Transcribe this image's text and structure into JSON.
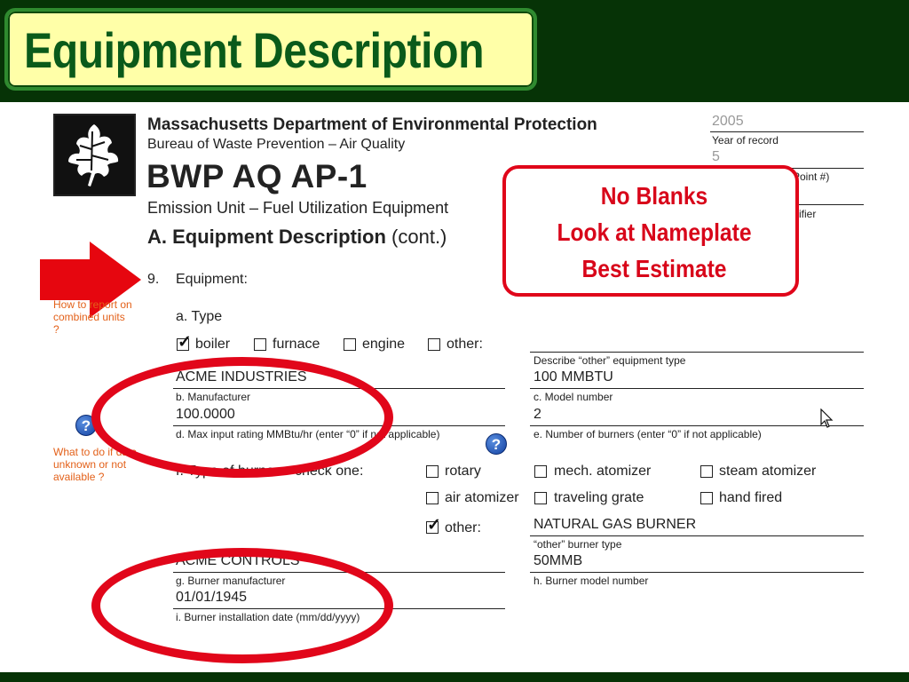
{
  "slide": {
    "title": "Equipment Description"
  },
  "form": {
    "agency": "Massachusetts Department of Environmental Protection",
    "bureau": "Bureau of Waste Prevention – Air Quality",
    "code": "BWP AQ AP-1",
    "subtitle": "Emission Unit – Fuel Utilization Equipment",
    "section_bold": "A. Equipment Description",
    "section_rest": " (cont.)",
    "meta": {
      "year_value": "2005",
      "year_label": "Year of record",
      "point_value": "5",
      "point_label_partial": "Point #)",
      "identifier_label_partial": "ifier"
    },
    "question_number": "9.",
    "question_label": "Equipment:",
    "type_label": "a. Type",
    "type_options": {
      "boiler": "boiler",
      "furnace": "furnace",
      "engine": "engine",
      "other": "other:"
    },
    "fields": {
      "other_type_label": "Describe “other” equipment type",
      "manufacturer_value": "ACME INDUSTRIES",
      "manufacturer_label": "b.  Manufacturer",
      "model_value": "100 MMBTU",
      "model_label": "c. Model number",
      "max_input_value": "100.0000",
      "max_input_label": "d. Max input rating MMBtu/hr (enter “0” if not applicable)",
      "burners_value": "2",
      "burners_label": "e. Number of burners (enter “0” if not applicable)",
      "burner_type_label": "f. Type of burner – check one:",
      "other_burner_value": "NATURAL GAS BURNER",
      "other_burner_label": "“other” burner type",
      "burner_mfr_value": "ACME CONTROLS",
      "burner_mfr_label": "g. Burner manufacturer",
      "burner_model_value": "50MMB",
      "burner_model_label": "h. Burner model number",
      "install_date_value": "01/01/1945",
      "install_date_label": "i. Burner installation date  (mm/dd/yyyy)"
    },
    "burner_options": {
      "rotary": "rotary",
      "mech_atomizer": "mech. atomizer",
      "steam_atomizer": "steam atomizer",
      "air_atomizer": "air atomizer",
      "traveling_grate": "traveling grate",
      "hand_fired": "hand fired",
      "other": "other:"
    },
    "side_notes": {
      "combined": "How to report on combined units ?",
      "unknown": "What to do if data unknown or not available ?"
    },
    "help_icon_glyph": "?"
  },
  "callout": {
    "line1": "No Blanks",
    "line2": "Look at Nameplate",
    "line3": "Best Estimate"
  },
  "colors": {
    "band": "#063306",
    "title_bg": "#ffffa8",
    "title_text": "#0a5a1a",
    "accent_red": "#e0061a",
    "note_orange": "#e3611a"
  },
  "icons": [
    "oak-leaf-logo-icon",
    "help-question-icon",
    "red-arrow-icon",
    "mouse-cursor-icon"
  ],
  "state": {
    "type_checked": "boiler",
    "burner_checked": "other"
  }
}
